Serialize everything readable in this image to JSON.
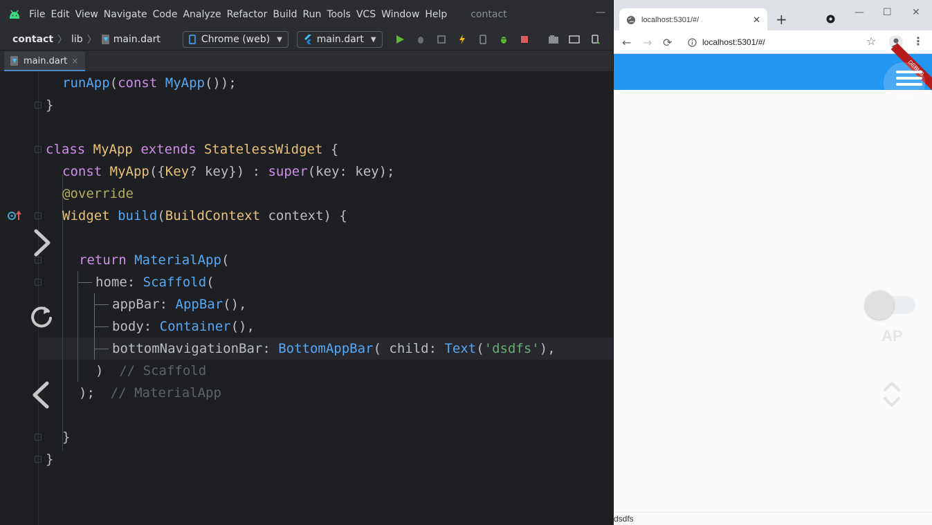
{
  "ide": {
    "menu": [
      "File",
      "Edit",
      "View",
      "Navigate",
      "Code",
      "Analyze",
      "Refactor",
      "Build",
      "Run",
      "Tools",
      "VCS",
      "Window",
      "Help"
    ],
    "project_title": "contact",
    "breadcrumb": {
      "project": "contact",
      "folder": "lib",
      "file": "main.dart"
    },
    "device_selector": "Chrome (web)",
    "run_config": "main.dart",
    "tab_label": "main.dart",
    "tab_close": "×",
    "win_min": "—",
    "code": {
      "l1": [
        "runApp",
        "(",
        "const",
        " ",
        "MyApp",
        "());"
      ],
      "l2": "}",
      "l4": [
        "class",
        " ",
        "MyApp",
        " ",
        "extends",
        " ",
        "StatelessWidget",
        " {"
      ],
      "l5": [
        "const",
        " ",
        "MyApp",
        "({",
        "Key",
        "? key}) : ",
        "super",
        "(key: key);"
      ],
      "l6": "@override",
      "l7": [
        "Widget",
        " ",
        "build",
        "(",
        "BuildContext",
        " context) {"
      ],
      "l9": [
        "return",
        " ",
        "MaterialApp",
        "("
      ],
      "l10": [
        "home: ",
        "Scaffold",
        "("
      ],
      "l11": [
        "appBar: ",
        "AppBar",
        "(),"
      ],
      "l12": [
        "body: ",
        "Container",
        "(),"
      ],
      "l13": [
        "bottomNavigationBar: ",
        "BottomAppBar",
        "( child: ",
        "Text",
        "(",
        "'dsdfs'",
        "),"
      ],
      "l13_tail": "),",
      "l14": [
        ")  ",
        "// Scaffold"
      ],
      "l15": [
        ");  ",
        "// MaterialApp"
      ],
      "l17": "}",
      "l18": "}"
    }
  },
  "browser": {
    "tab_title": "localhost:5301/#/",
    "tab_close": "✕",
    "new_tab": "+",
    "url": "localhost:5301/#/",
    "win_min": "—",
    "win_max": "☐",
    "win_close": "✕",
    "back": "←",
    "forward": "→",
    "reload": "⟳",
    "star": "☆",
    "menu": "⋮",
    "debug_banner": "DEBUG",
    "ap_label": "AP",
    "bottom_text": "dsdfs",
    "appbar_color": "#2196f3"
  }
}
